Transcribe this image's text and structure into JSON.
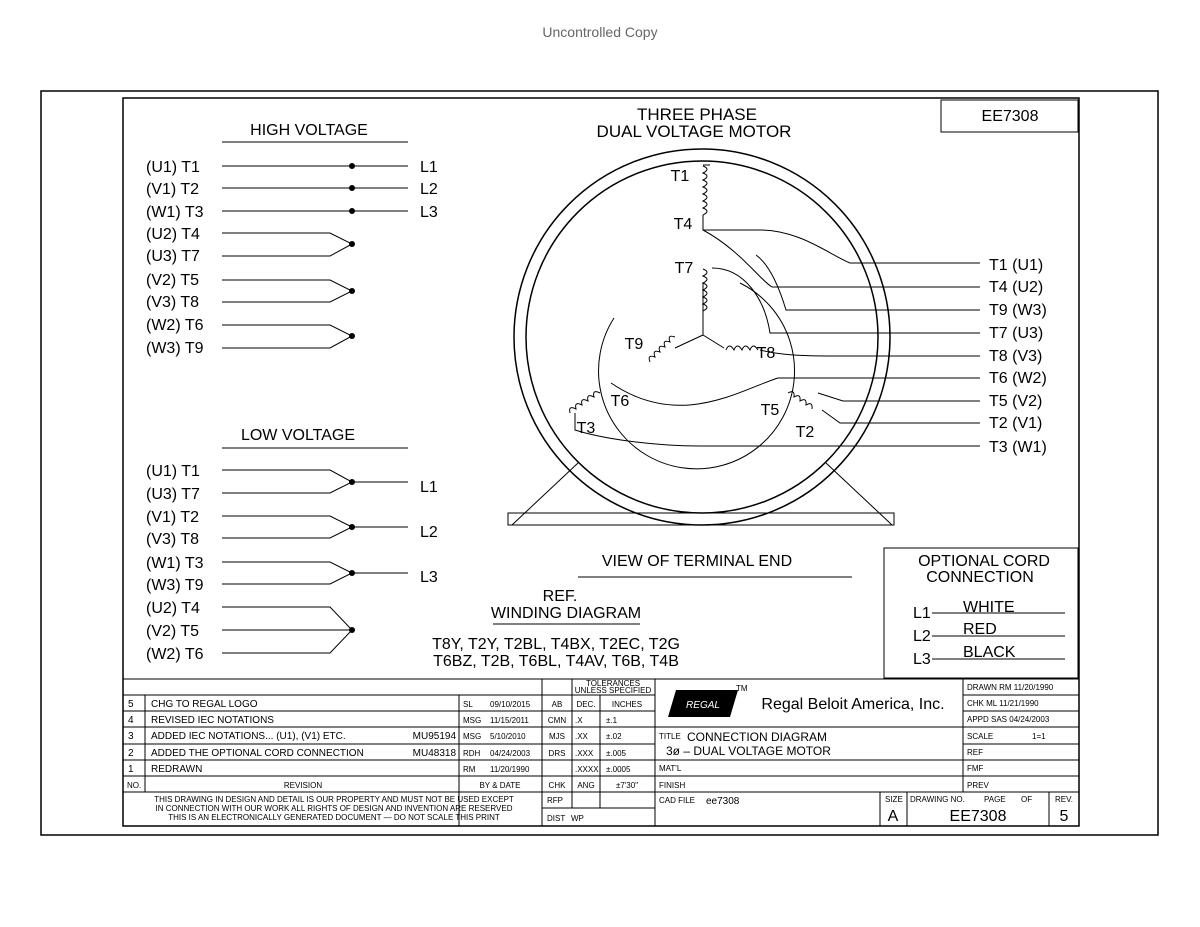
{
  "header": {
    "watermark": "Uncontrolled Copy"
  },
  "title": {
    "line1": "THREE PHASE",
    "line2": "DUAL VOLTAGE MOTOR",
    "drawing_number": "EE7308"
  },
  "high_voltage": {
    "heading": "HIGH VOLTAGE",
    "leads": [
      "(U1) T1",
      "(V1) T2",
      "(W1) T3",
      "(U2) T4",
      "(U3) T7",
      "(V2) T5",
      "(V3) T8",
      "(W2) T6",
      "(W3) T9"
    ],
    "lines": [
      "L1",
      "L2",
      "L3"
    ]
  },
  "low_voltage": {
    "heading": "LOW VOLTAGE",
    "leads": [
      "(U1) T1",
      "(U3) T7",
      "(V1) T2",
      "(V3) T8",
      "(W1) T3",
      "(W3) T9",
      "(U2) T4",
      "(V2) T5",
      "(W2) T6"
    ],
    "lines": [
      "L1",
      "L2",
      "L3"
    ]
  },
  "motor": {
    "windings": [
      "T1",
      "T4",
      "T7",
      "T9",
      "T8",
      "T6",
      "T3",
      "T5",
      "T2"
    ],
    "terminals": [
      "T1 (U1)",
      "T4 (U2)",
      "T9 (W3)",
      "T7 (U3)",
      "T8 (V3)",
      "T6 (W2)",
      "T5 (V2)",
      "T2 (V1)",
      "T3 (W1)"
    ],
    "view_label": "VIEW OF TERMINAL END"
  },
  "ref_winding": {
    "ref": "REF.",
    "heading": "WINDING DIAGRAM",
    "line1": "T8Y, T2Y, T2BL, T4BX, T2EC, T2G",
    "line2": "T6BZ, T2B, T6BL, T4AV, T6B, T4B"
  },
  "cord": {
    "heading1": "OPTIONAL CORD",
    "heading2": "CONNECTION",
    "rows": [
      {
        "line": "L1",
        "color": "WHITE"
      },
      {
        "line": "L2",
        "color": "RED"
      },
      {
        "line": "L3",
        "color": "BLACK"
      }
    ]
  },
  "revisions": {
    "rows": [
      {
        "no": "5",
        "desc": "CHG TO REGAL LOGO",
        "by": "SL",
        "date": "09/10/2015",
        "chk": "AB"
      },
      {
        "no": "4",
        "desc": "REVISED IEC NOTATIONS",
        "by": "MSG",
        "date": "11/15/2011",
        "chk": "CMN"
      },
      {
        "no": "3",
        "desc": "ADDED IEC NOTATIONS... (U1), (V1) ETC.",
        "ref": "MU95194",
        "by": "MSG",
        "date": "5/10/2010",
        "chk": "MJS"
      },
      {
        "no": "2",
        "desc": "ADDED THE OPTIONAL CORD CONNECTION",
        "ref": "MU48318",
        "by": "RDH",
        "date": "04/24/2003",
        "chk": "DRS"
      },
      {
        "no": "1",
        "desc": "REDRAWN",
        "by": "RM",
        "date": "11/20/1990",
        "chk": ""
      }
    ],
    "col_no": "NO.",
    "col_revision": "REVISION",
    "col_bydate": "BY & DATE",
    "col_chk": "CHK"
  },
  "tolerances": {
    "heading1": "TOLERANCES",
    "heading2": "UNLESS SPECIFIED",
    "col_dec": "DEC.",
    "col_inches": "INCHES",
    "rows": [
      {
        "dec": ".X",
        "val": "±.1"
      },
      {
        "dec": ".XX",
        "val": "±.02"
      },
      {
        "dec": ".XXX",
        "val": "±.005"
      },
      {
        "dec": ".XXXX",
        "val": "±.0005"
      }
    ],
    "ang_label": "ANG",
    "ang_val": "±7'30\""
  },
  "titleblock": {
    "company": "Regal Beloit America, Inc.",
    "logo_text": "REGAL",
    "tm": "TM",
    "title_label": "TITLE",
    "title_line1": "CONNECTION DIAGRAM",
    "title_line2": "3ø – DUAL VOLTAGE MOTOR",
    "matl": "MAT'L",
    "finish": "FINISH",
    "cad_label": "CAD FILE",
    "cad_file": "ee7308",
    "rfp": "RFP",
    "dist": "DIST",
    "dist_val": "WP",
    "drawn": "DRAWN RM 11/20/1990",
    "chk": "CHK ML 11/21/1990",
    "appd": "APPD SAS 04/24/2003",
    "scale_label": "SCALE",
    "scale": "1=1",
    "ref": "REF",
    "fmf": "FMF",
    "prev": "PREV",
    "size_label": "SIZE",
    "size": "A",
    "drawing_no_label": "DRAWING NO.",
    "page_label": "PAGE",
    "of_label": "OF",
    "rev_label": "REV.",
    "drawing_no": "EE7308",
    "rev": "5",
    "notice1": "THIS DRAWING IN DESIGN AND DETAIL IS OUR PROPERTY AND MUST NOT BE USED EXCEPT",
    "notice2": "IN CONNECTION WITH OUR WORK ALL RIGHTS OF DESIGN AND INVENTION ARE RESERVED",
    "notice3": "THIS IS AN ELECTRONICALLY GENERATED DOCUMENT — DO NOT SCALE THIS PRINT"
  }
}
